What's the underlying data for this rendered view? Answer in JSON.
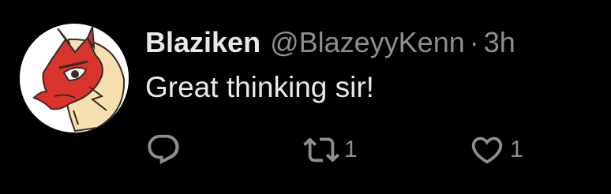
{
  "tweet": {
    "display_name": "Blaziken",
    "handle": "@BlazeyyKenn",
    "separator": "·",
    "time": "3h",
    "text": "Great thinking sir!"
  },
  "actions": {
    "reply_icon": "reply-icon",
    "retweet_icon": "retweet-icon",
    "retweet_count": "1",
    "like_icon": "heart-icon",
    "like_count": "1"
  },
  "colors": {
    "background": "#000000",
    "primary_text": "#e7e9ea",
    "secondary_text": "#8b8f94",
    "avatar_red": "#d9342b",
    "avatar_cream": "#f6e0b0"
  }
}
